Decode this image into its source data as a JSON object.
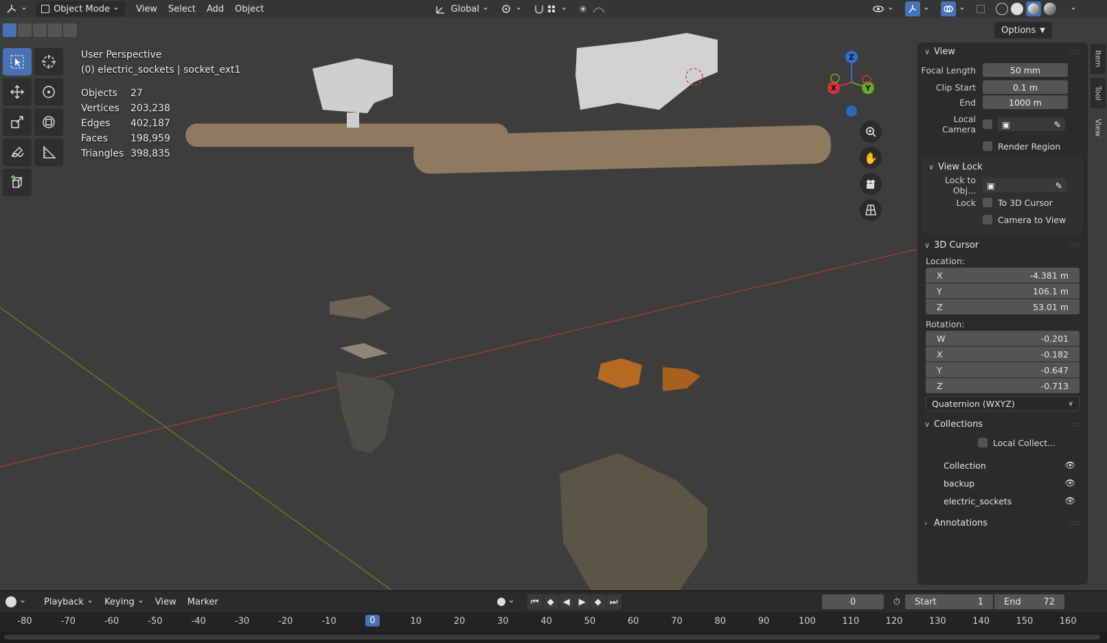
{
  "header": {
    "mode_label": "Object Mode",
    "menus": [
      "View",
      "Select",
      "Add",
      "Object"
    ],
    "orientation_label": "Global"
  },
  "options_label": "Options",
  "overlay": {
    "perspective": "User Perspective",
    "context": "(0) electric_sockets | socket_ext1"
  },
  "stats": [
    {
      "label": "Objects",
      "value": "27"
    },
    {
      "label": "Vertices",
      "value": "203,238"
    },
    {
      "label": "Edges",
      "value": "402,187"
    },
    {
      "label": "Faces",
      "value": "198,959"
    },
    {
      "label": "Triangles",
      "value": "398,835"
    }
  ],
  "gizmo": {
    "z": "Z",
    "x": "X",
    "y": "Y"
  },
  "side_tabs": [
    "Item",
    "Tool",
    "View"
  ],
  "panel": {
    "view": {
      "title": "View",
      "focal_length_label": "Focal Length",
      "focal_length": "50 mm",
      "clip_start_label": "Clip Start",
      "clip_start": "0.1 m",
      "end_label": "End",
      "end": "1000 m",
      "local_camera_label": "Local Camera",
      "render_region_label": "Render Region"
    },
    "view_lock": {
      "title": "View Lock",
      "lock_to_obj_label": "Lock to Obj...",
      "lock_label": "Lock",
      "to_cursor_label": "To 3D Cursor",
      "camera_to_view_label": "Camera to View"
    },
    "cursor": {
      "title": "3D Cursor",
      "location_label": "Location:",
      "location": [
        {
          "axis": "X",
          "value": "-4.381 m"
        },
        {
          "axis": "Y",
          "value": "106.1 m"
        },
        {
          "axis": "Z",
          "value": "53.01 m"
        }
      ],
      "rotation_label": "Rotation:",
      "rotation": [
        {
          "axis": "W",
          "value": "-0.201"
        },
        {
          "axis": "X",
          "value": "-0.182"
        },
        {
          "axis": "Y",
          "value": "-0.647"
        },
        {
          "axis": "Z",
          "value": "-0.713"
        }
      ],
      "rotation_mode": "Quaternion (WXYZ)"
    },
    "collections": {
      "title": "Collections",
      "local_label": "Local Collect...",
      "items": [
        "Collection",
        "backup",
        "electric_sockets"
      ]
    },
    "annotations": {
      "title": "Annotations"
    }
  },
  "timeline": {
    "menus": [
      "Playback",
      "Keying",
      "View",
      "Marker"
    ],
    "current_frame": "0",
    "start_label": "Start",
    "start": "1",
    "end_label": "End",
    "end": "72",
    "ticks": [
      "-80",
      "-70",
      "-60",
      "-50",
      "-40",
      "-30",
      "-20",
      "-10",
      "0",
      "10",
      "20",
      "30",
      "40",
      "50",
      "60",
      "70",
      "80",
      "90",
      "100",
      "110",
      "120",
      "130",
      "140",
      "150",
      "160"
    ]
  },
  "colors": {
    "accent": "#4772b3",
    "x_axis": "#c43c3c",
    "y_axis": "#6a9a2a",
    "z_axis": "#2f6fcf"
  }
}
